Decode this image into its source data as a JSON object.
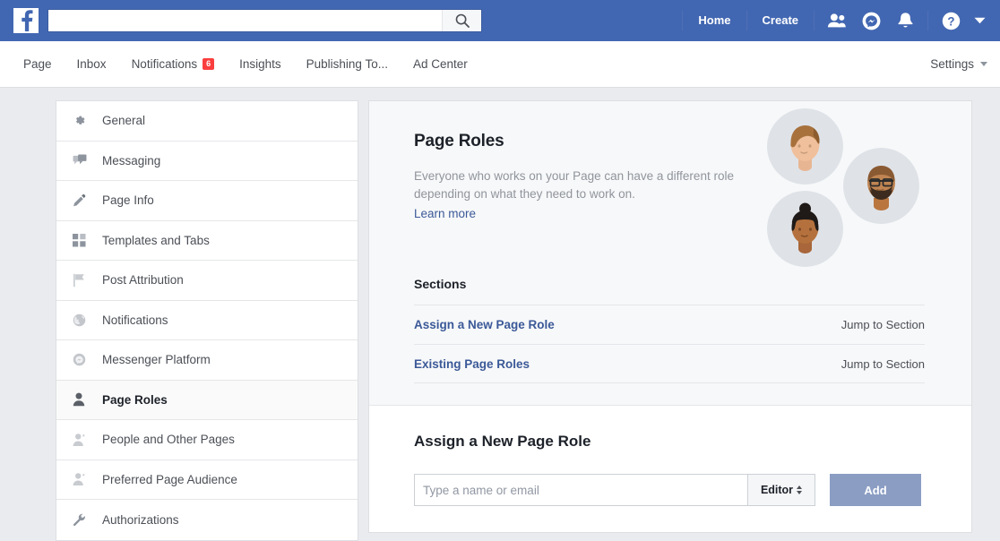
{
  "topbar": {
    "logo_icon": "facebook-f-logo",
    "search": {
      "value": "",
      "placeholder": "",
      "icon": "search-icon"
    },
    "links": [
      {
        "label": "Home",
        "name": "home-link"
      },
      {
        "label": "Create",
        "name": "create-link"
      }
    ],
    "icons": [
      {
        "name": "friend-requests-icon",
        "glyph": "people"
      },
      {
        "name": "messenger-icon",
        "glyph": "messenger"
      },
      {
        "name": "notifications-bell-icon",
        "glyph": "bell"
      },
      {
        "name": "help-icon",
        "glyph": "question-circle"
      },
      {
        "name": "account-dropdown-caret-icon",
        "glyph": "caret-down"
      }
    ]
  },
  "subnav": {
    "items": [
      {
        "label": "Page",
        "badge": ""
      },
      {
        "label": "Inbox",
        "badge": ""
      },
      {
        "label": "Notifications",
        "badge": "6"
      },
      {
        "label": "Insights",
        "badge": ""
      },
      {
        "label": "Publishing To...",
        "badge": ""
      },
      {
        "label": "Ad Center",
        "badge": ""
      }
    ],
    "settings_label": "Settings"
  },
  "sidebar": {
    "items": [
      {
        "label": "General",
        "icon": "gear-icon",
        "active": false
      },
      {
        "label": "Messaging",
        "icon": "chat-bubbles-icon",
        "active": false
      },
      {
        "label": "Page Info",
        "icon": "pencil-icon",
        "active": false
      },
      {
        "label": "Templates and Tabs",
        "icon": "grid-squares-icon",
        "active": false
      },
      {
        "label": "Post Attribution",
        "icon": "flag-icon",
        "active": false
      },
      {
        "label": "Notifications",
        "icon": "globe-icon",
        "active": false
      },
      {
        "label": "Messenger Platform",
        "icon": "messenger-circle-icon",
        "active": false
      },
      {
        "label": "Page Roles",
        "icon": "person-icon",
        "active": true
      },
      {
        "label": "People and Other Pages",
        "icon": "person-star-icon",
        "active": false
      },
      {
        "label": "Preferred Page Audience",
        "icon": "person-star-icon",
        "active": false
      },
      {
        "label": "Authorizations",
        "icon": "wrench-icon",
        "active": false
      }
    ]
  },
  "main": {
    "header": {
      "title": "Page Roles",
      "description": "Everyone who works on your Page can have a different role depending on what they need to work on.",
      "learn_more": "Learn more"
    },
    "avatars": [
      {
        "name": "avatar-person-short-hair",
        "skin": "#e8b593",
        "hair": "#a8713c",
        "bg": "#dfe3e8"
      },
      {
        "name": "avatar-person-beard-glasses",
        "skin": "#c08552",
        "hair": "#3d2b1f",
        "bg": "#dfe3e8"
      },
      {
        "name": "avatar-person-bun-hair",
        "skin": "#b5713d",
        "hair": "#1f1a17",
        "bg": "#dfe3e8"
      }
    ],
    "sections": {
      "title": "Sections",
      "rows": [
        {
          "name": "Assign a New Page Role",
          "jump": "Jump to Section"
        },
        {
          "name": "Existing Page Roles",
          "jump": "Jump to Section"
        }
      ]
    },
    "assign": {
      "title": "Assign a New Page Role",
      "input_value": "",
      "input_placeholder": "Type a name or email",
      "role_value": "Editor",
      "add_label": "Add"
    }
  },
  "colors": {
    "brand_blue": "#4267b2",
    "page_bg": "#e9ebee",
    "link_blue": "#3b5998",
    "badge_red": "#fa3e3e",
    "add_button": "#8b9dc3"
  }
}
